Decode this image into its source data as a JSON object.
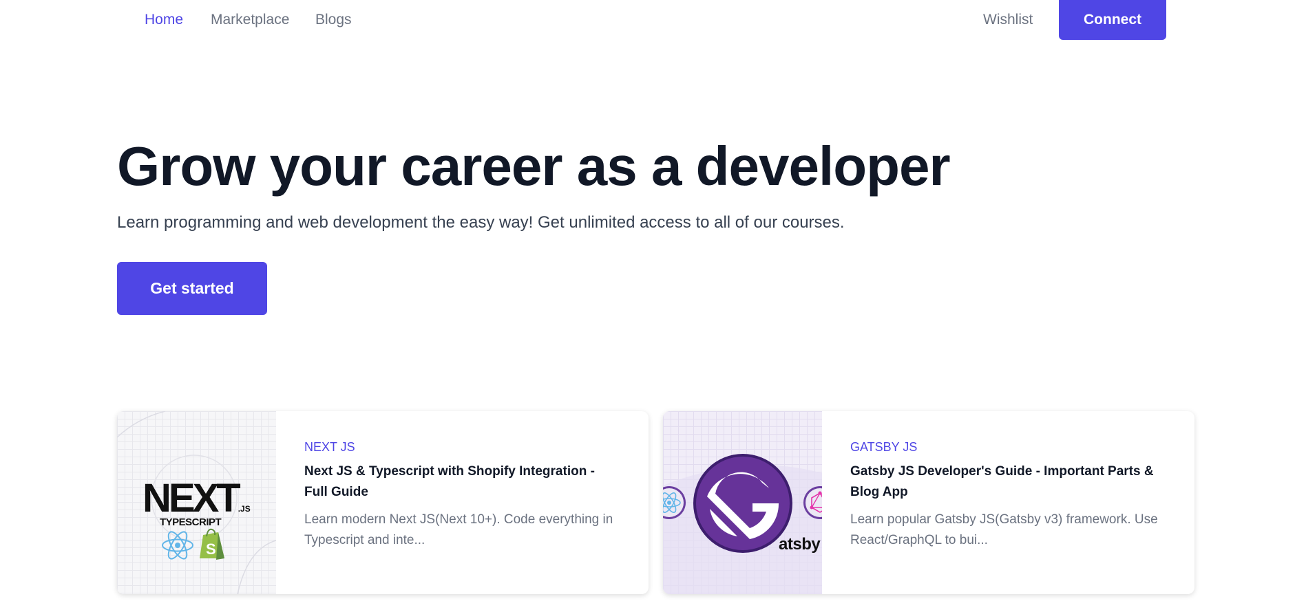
{
  "nav": {
    "links": [
      "Home",
      "Marketplace",
      "Blogs"
    ],
    "wishlist": "Wishlist",
    "connect": "Connect",
    "accent": "#4f46e5"
  },
  "hero": {
    "title": "Grow your career as a developer",
    "subtitle": "Learn programming and web development the easy way! Get unlimited access to all of our courses.",
    "cta": "Get started"
  },
  "cards": [
    {
      "category": "NEXT JS",
      "title": "Next JS & Typescript with Shopify Integration - Full Guide",
      "description": "Learn modern Next JS(Next 10+). Code everything in Typescript and inte...",
      "image": {
        "logo_main": "NEXT",
        "logo_suffix": ".JS",
        "logo_sub": "TYPESCRIPT",
        "icons": [
          "react-icon",
          "shopify-icon"
        ]
      }
    },
    {
      "category": "GATSBY JS",
      "title": "Gatsby JS Developer's Guide - Important Parts & Blog App",
      "description": "Learn popular Gatsby JS(Gatsby v3) framework. Use React/GraphQL to bui...",
      "image": {
        "logo_text": "atsby",
        "icons": [
          "gatsby-icon",
          "react-icon",
          "graphql-icon"
        ]
      }
    }
  ]
}
